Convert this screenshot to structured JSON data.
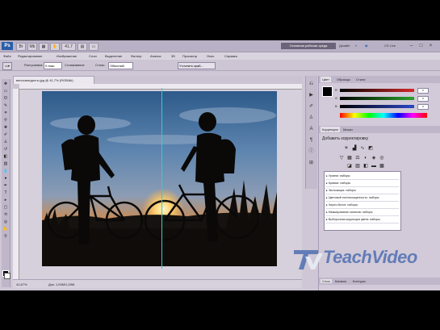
{
  "appbar": {
    "logo": "Ps",
    "zoom_label": "41,7",
    "workspace_label": "Основная рабочая среда",
    "design_label": "Дизайн",
    "cs_live_label": "CS Live"
  },
  "menu": [
    "Файл",
    "Редактирование",
    "Изображение",
    "Слои",
    "Выделение",
    "Фильтр",
    "Анализ",
    "3D",
    "Просмотр",
    "Окно",
    "Справка"
  ],
  "options": {
    "feather_label": "Растушевка:",
    "feather_value": "0 пикс",
    "antialias_label": "Сглаживание",
    "style_label": "Стиль:",
    "style_value": "Обычный",
    "refine_label": "Уточнить край..."
  },
  "document": {
    "tab_title": "велосипедисты.jpg @ 41,7% (RGB/8#)",
    "status_zoom": "41,67%",
    "status_doc": "Док: 1,00М/1,00М"
  },
  "panels": {
    "color_tabs": [
      "Цвет",
      "Образцы",
      "Стили"
    ],
    "sliders": [
      {
        "label": "R",
        "value": "0",
        "color": "#d42a2a"
      },
      {
        "label": "G",
        "value": "0",
        "color": "#2aa32a"
      },
      {
        "label": "B",
        "value": "0",
        "color": "#2a48c8"
      }
    ],
    "adj_tabs": [
      "Коррекция",
      "Маски"
    ],
    "adj_title": "Добавить корректировку",
    "presets": [
      "Уровни: наборы",
      "Кривые: наборы",
      "Экспозиция: наборы",
      "Цветовой тон/насыщенность: наборы",
      "Черно-белое: наборы",
      "Микширование каналов: наборы",
      "Выборочная коррекция цвета: наборы"
    ],
    "bottom_tabs": [
      "Слои",
      "Каналы",
      "Контуры"
    ]
  },
  "watermark": {
    "brand": "TeachVideo"
  }
}
